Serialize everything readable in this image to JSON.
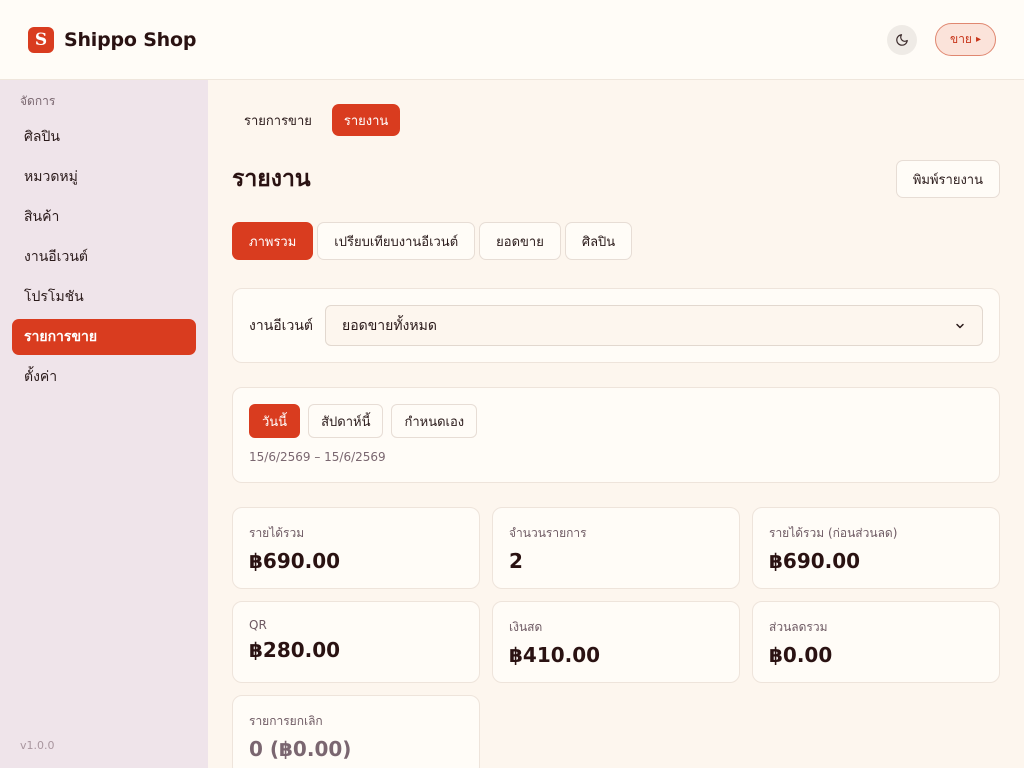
{
  "header": {
    "logo_letter": "S",
    "brand_name": "Shippo Shop",
    "sell_label": "ขาย",
    "sell_arrow": "▸"
  },
  "sidebar": {
    "section": "จัดการ",
    "items": [
      {
        "label": "ศิลปิน"
      },
      {
        "label": "หมวดหมู่"
      },
      {
        "label": "สินค้า"
      },
      {
        "label": "งานอีเวนต์"
      },
      {
        "label": "โปรโมชัน"
      },
      {
        "label": "รายการขาย"
      },
      {
        "label": "ตั้งค่า"
      }
    ],
    "active_index": 5,
    "version": "v1.0.0"
  },
  "main": {
    "top_tabs": [
      "รายการขาย",
      "รายงาน"
    ],
    "active_top_tab": 1,
    "title": "รายงาน",
    "print_label": "พิมพ์รายงาน",
    "sub_tabs": [
      "ภาพรวม",
      "เปรียบเทียบงานอีเวนต์",
      "ยอดขาย",
      "ศิลปิน"
    ],
    "active_sub_tab": 0,
    "event_filter": {
      "label": "งานอีเวนต์",
      "selected": "ยอดขายทั้งหมด"
    },
    "date_range": {
      "buttons": [
        "วันนี้",
        "สัปดาห์นี้",
        "กำหนดเอง"
      ],
      "active": 0,
      "text": "15/6/2569 – 15/6/2569"
    },
    "stats": [
      {
        "label": "รายได้รวม",
        "value": "฿690.00"
      },
      {
        "label": "จำนวนรายการ",
        "value": "2"
      },
      {
        "label": "รายได้รวม (ก่อนส่วนลด)",
        "value": "฿690.00"
      },
      {
        "label": "QR",
        "value": "฿280.00"
      },
      {
        "label": "เงินสด",
        "value": "฿410.00"
      },
      {
        "label": "ส่วนลดรวม",
        "value": "฿0.00"
      },
      {
        "label": "รายการยกเลิก",
        "value": "0 (฿0.00)"
      }
    ]
  },
  "colors": {
    "accent": "#d93c1f",
    "sidebar_bg": "#efe4ea",
    "page_bg": "#fdf6ee"
  },
  "icons": {
    "theme": "moon-icon",
    "select": "chevron-down-icon"
  }
}
